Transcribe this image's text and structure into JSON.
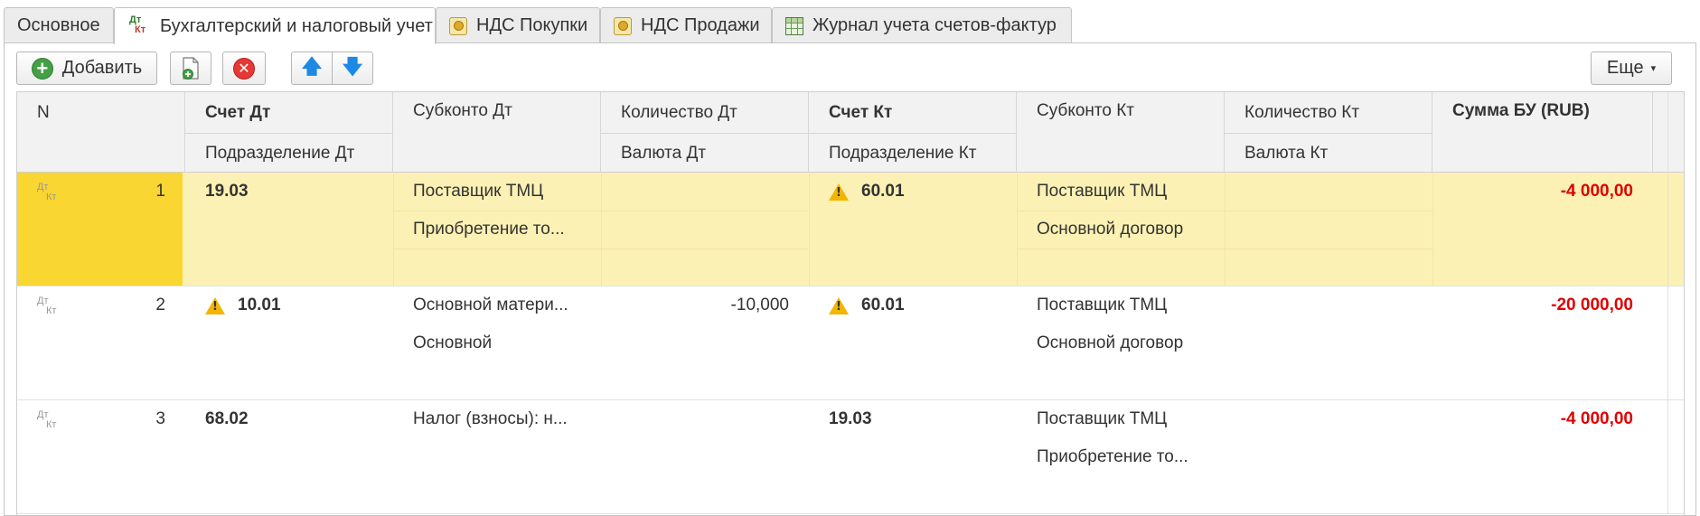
{
  "tabs": [
    {
      "label": "Основное"
    },
    {
      "label": "Бухгалтерский и налоговый учет",
      "icon": "dt-kt-icon"
    },
    {
      "label": "НДС Покупки",
      "icon": "coin-icon"
    },
    {
      "label": "НДС Продажи",
      "icon": "coin-icon"
    },
    {
      "label": "Журнал учета счетов-фактур",
      "icon": "journal-grid-icon"
    }
  ],
  "tab_icon_text": {
    "dt": "Дт",
    "kt": "Кт"
  },
  "toolbar": {
    "add_label": "Добавить",
    "more_label": "Еще",
    "more_caret": "▾"
  },
  "table": {
    "headers": {
      "n": "N",
      "schet_dt": "Счет Дт",
      "podrazd_dt": "Подразделение Дт",
      "subkonto_dt": "Субконто Дт",
      "kol_dt": "Количество Дт",
      "valuta_dt": "Валюта Дт",
      "schet_kt": "Счет Кт",
      "podrazd_kt": "Подразделение Кт",
      "subkonto_kt": "Субконто Кт",
      "kol_kt": "Количество Кт",
      "valuta_kt": "Валюта Кт",
      "summa": "Сумма БУ (RUB)"
    },
    "rows": [
      {
        "n": "1",
        "schet_dt": "19.03",
        "subkonto_dt_1": "Поставщик ТМЦ",
        "subkonto_dt_2": "Приобретение то...",
        "schet_kt": "60.01",
        "subkonto_kt_1": "Поставщик ТМЦ",
        "subkonto_kt_2": "Основной договор",
        "summa": "-4 000,00"
      },
      {
        "n": "2",
        "schet_dt": "10.01",
        "podrazd_dt": "",
        "subkonto_dt_1": "Основной матери...",
        "subkonto_dt_2": "Основной",
        "kol_dt": "-10,000",
        "schet_kt": "60.01",
        "subkonto_kt_1": "Поставщик ТМЦ",
        "subkonto_kt_2": "Основной договор",
        "summa": "-20 000,00"
      },
      {
        "n": "3",
        "schet_dt": "68.02",
        "subkonto_dt_1": "Налог (взносы): н...",
        "schet_kt": "19.03",
        "subkonto_kt_1": "Поставщик ТМЦ",
        "subkonto_kt_2": "Приобретение то...",
        "summa": "-4 000,00"
      }
    ],
    "row_icon": {
      "dt": "Дт",
      "kt": "Кт"
    }
  },
  "colors": {
    "selected_row": "#fbf1b4",
    "selected_number_cell": "#f9d631",
    "negative_amount": "#e00000",
    "warning": "#f2b500"
  }
}
